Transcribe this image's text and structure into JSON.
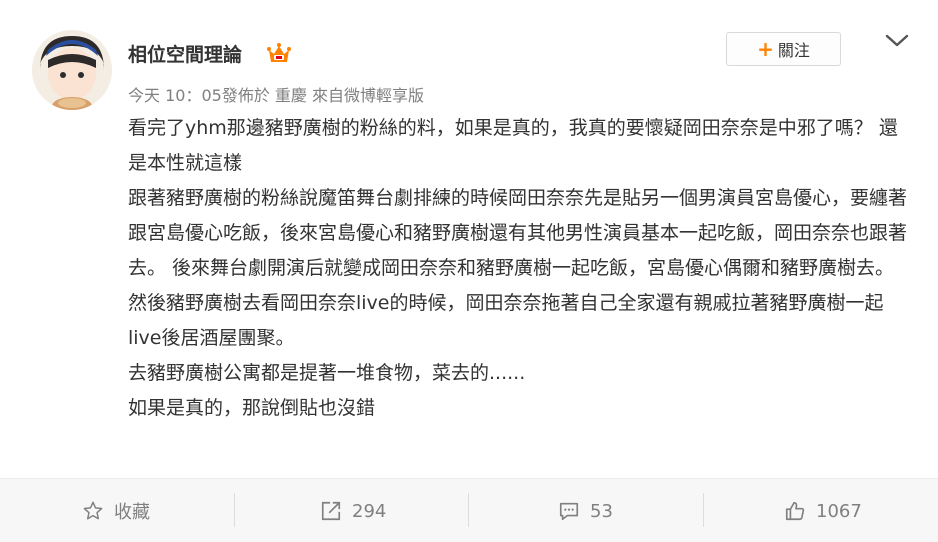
{
  "post": {
    "author": "相位空間理論",
    "meta": {
      "time": "今天 10：05",
      "published_at_prefix": "發佈於 ",
      "location": "重慶",
      "source_prefix": " 來自",
      "source": "微博輕享版"
    },
    "follow_label": "關注",
    "paragraphs": [
      "看完了yhm那邊豬野廣樹的粉絲的料，如果是真的，我真的要懷疑岡田奈奈是中邪了嗎？ 還是本性就這樣",
      "跟著豬野廣樹的粉絲說魔笛舞台劇排練的時候岡田奈奈先是貼另一個男演員宮島優心，要纏著跟宮島優心吃飯，後來宮島優心和豬野廣樹還有其他男性演員基本一起吃飯，岡田奈奈也跟著去。 後來舞台劇開演后就變成岡田奈奈和豬野廣樹一起吃飯，宮島優心偶爾和豬野廣樹去。",
      "然後豬野廣樹去看岡田奈奈live的時候，岡田奈奈拖著自己全家還有親戚拉著豬野廣樹一起live後居酒屋團聚。",
      "去豬野廣樹公寓都是提著一堆食物，菜去的......",
      "如果是真的，那說倒貼也沒錯"
    ]
  },
  "actions": {
    "favorite": "收藏",
    "reposts": "294",
    "comments": "53",
    "likes": "1067"
  },
  "icons": {
    "vip": "vip-crown-icon",
    "chevron": "chevron-down-icon",
    "favorite": "star-icon",
    "repost": "repost-icon",
    "comment": "comment-icon",
    "like": "thumbs-up-icon"
  },
  "colors": {
    "accent": "#ff8200",
    "muted": "#808080",
    "text": "#333333",
    "bar": "#f7f7f7"
  }
}
